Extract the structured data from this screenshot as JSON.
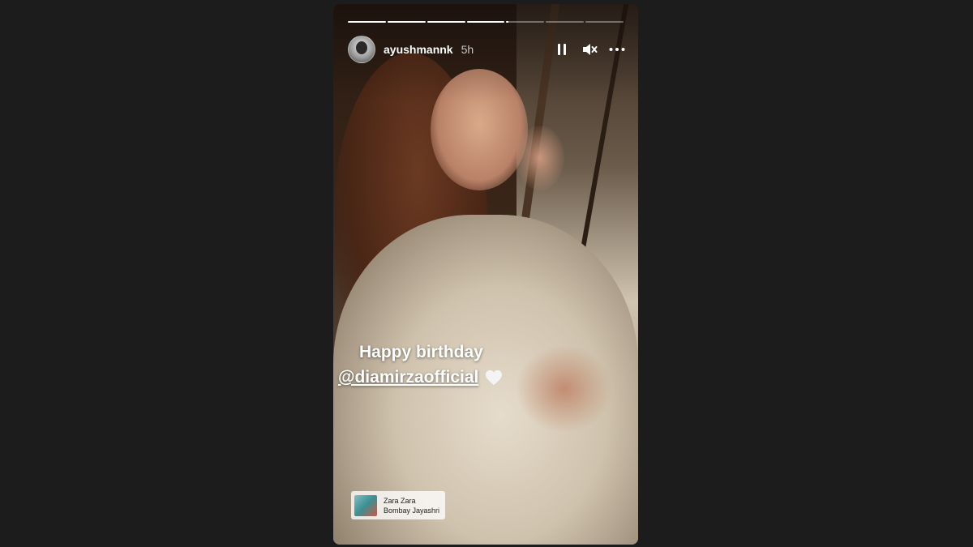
{
  "story": {
    "username": "ayushmannk",
    "time": "5h",
    "progress": [
      1,
      1,
      1,
      1,
      0.05,
      0,
      0
    ],
    "caption": {
      "line1": "Happy birthday",
      "mention": "@diamirzaofficial"
    },
    "music": {
      "title": "Zara Zara",
      "artist": "Bombay Jayashri"
    }
  },
  "icons": {
    "pause": "pause-icon",
    "mute": "speaker-muted-icon",
    "more": "more-horizontal-icon",
    "heart": "white-heart-icon"
  },
  "colors": {
    "background": "#1c1c1c",
    "text": "#ffffff"
  }
}
